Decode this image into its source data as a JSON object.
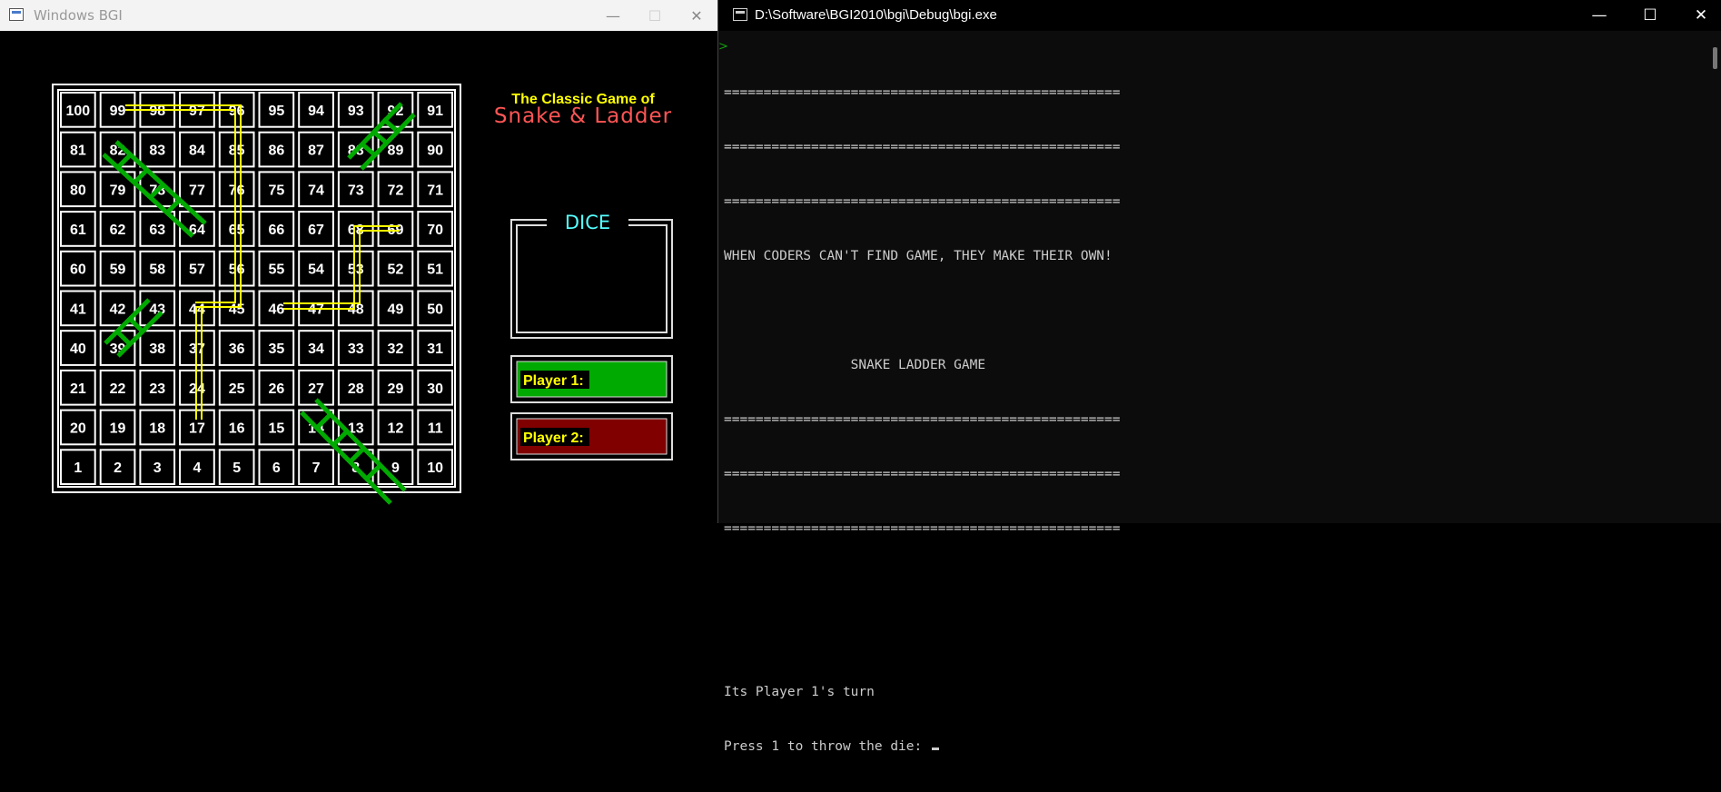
{
  "left_window": {
    "title": "Windows BGI",
    "controls": {
      "minimize": "—",
      "maximize": "☐",
      "close": "✕"
    }
  },
  "board": {
    "header_line1": "The Classic Game of",
    "header_line2": "Snake & Ladder",
    "rows": [
      [
        "100",
        "99",
        "98",
        "97",
        "96",
        "95",
        "94",
        "93",
        "92",
        "91"
      ],
      [
        "81",
        "82",
        "83",
        "84",
        "85",
        "86",
        "87",
        "88",
        "89",
        "90"
      ],
      [
        "80",
        "79",
        "78",
        "77",
        "76",
        "75",
        "74",
        "73",
        "72",
        "71"
      ],
      [
        "61",
        "62",
        "63",
        "64",
        "65",
        "66",
        "67",
        "68",
        "69",
        "70"
      ],
      [
        "60",
        "59",
        "58",
        "57",
        "56",
        "55",
        "54",
        "53",
        "52",
        "51"
      ],
      [
        "41",
        "42",
        "43",
        "44",
        "45",
        "46",
        "47",
        "48",
        "49",
        "50"
      ],
      [
        "40",
        "39",
        "38",
        "37",
        "36",
        "35",
        "34",
        "33",
        "32",
        "31"
      ],
      [
        "21",
        "22",
        "23",
        "24",
        "25",
        "26",
        "27",
        "28",
        "29",
        "30"
      ],
      [
        "20",
        "19",
        "18",
        "17",
        "16",
        "15",
        "14",
        "13",
        "12",
        "11"
      ],
      [
        "1",
        "2",
        "3",
        "4",
        "5",
        "6",
        "7",
        "8",
        "9",
        "10"
      ]
    ],
    "dice_label": "DICE",
    "player1_label": "Player 1:",
    "player2_label": "Player 2:",
    "colors": {
      "grid": "#ffffff",
      "header_yellow": "#ffff00",
      "header_red": "#ff5555",
      "dice_cyan": "#55ffff",
      "ladder_green": "#00aa00",
      "snake_yellow": "#ffff00",
      "player1_green": "#00aa00",
      "player2_red": "#aa0000"
    }
  },
  "right_window": {
    "title": "D:\\Software\\BGI2010\\bgi\\Debug\\bgi.exe",
    "controls": {
      "minimize": "—",
      "maximize": "☐",
      "close": "✕"
    },
    "console_lines": [
      "==================================================",
      "==================================================",
      "==================================================",
      "WHEN CODERS CAN'T FIND GAME, THEY MAKE THEIR OWN!",
      "",
      "                SNAKE LADDER GAME",
      "==================================================",
      "==================================================",
      "==================================================",
      "",
      "",
      "Its Player 1's turn",
      "Press 1 to throw the die: "
    ]
  }
}
